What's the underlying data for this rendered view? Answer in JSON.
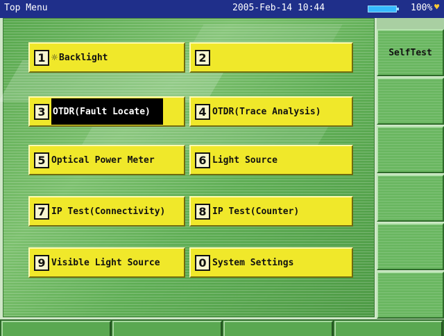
{
  "titlebar": {
    "title": "Top Menu",
    "datetime": "2005-Feb-14 10:44",
    "battery_percent": "100%",
    "battery_level": 1.0
  },
  "menu": {
    "items": [
      {
        "num": "1",
        "label": "Backlight",
        "icon": "sun-icon"
      },
      {
        "num": "2",
        "label": ""
      },
      {
        "num": "3",
        "label": "OTDR(Fault Locate)",
        "selected": true
      },
      {
        "num": "4",
        "label": "OTDR(Trace Analysis)"
      },
      {
        "num": "5",
        "label": "Optical Power Meter"
      },
      {
        "num": "6",
        "label": "Light Source"
      },
      {
        "num": "7",
        "label": "IP Test(Connectivity)"
      },
      {
        "num": "8",
        "label": "IP Test(Counter)"
      },
      {
        "num": "9",
        "label": "Visible Light Source"
      },
      {
        "num": "0",
        "label": "System Settings"
      }
    ]
  },
  "softkeys": {
    "items": [
      {
        "label": "SelfTest"
      },
      {
        "label": ""
      },
      {
        "label": ""
      },
      {
        "label": ""
      },
      {
        "label": ""
      },
      {
        "label": ""
      }
    ]
  },
  "colors": {
    "titlebar_bg": "#1f2f8a",
    "button_yellow": "#f0e82a",
    "panel_green": "#6ab761",
    "selected_bg": "#000000"
  }
}
